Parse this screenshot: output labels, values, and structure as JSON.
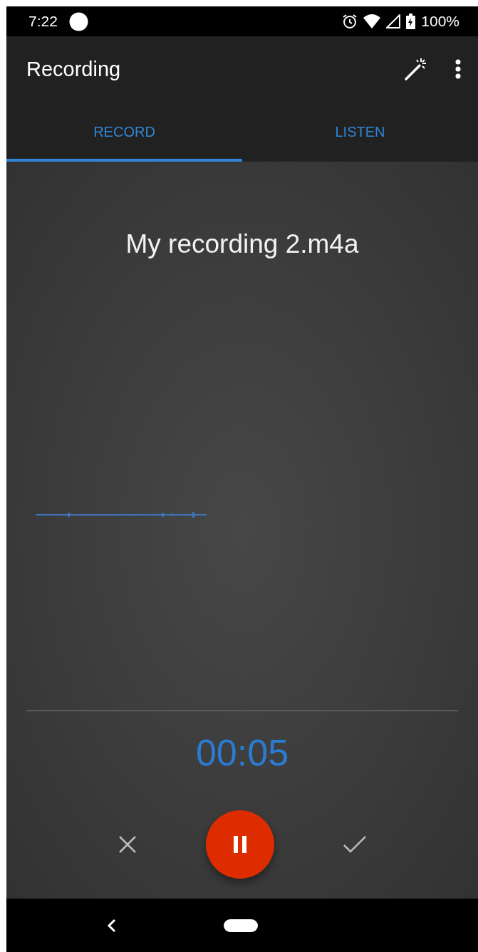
{
  "status_bar": {
    "time": "7:22",
    "battery": "100%"
  },
  "app_bar": {
    "title": "Recording"
  },
  "tabs": [
    {
      "label": "RECORD",
      "selected": true
    },
    {
      "label": "LISTEN",
      "selected": false
    }
  ],
  "recording": {
    "file_name": "My recording 2.m4a",
    "timer": "00:05"
  }
}
